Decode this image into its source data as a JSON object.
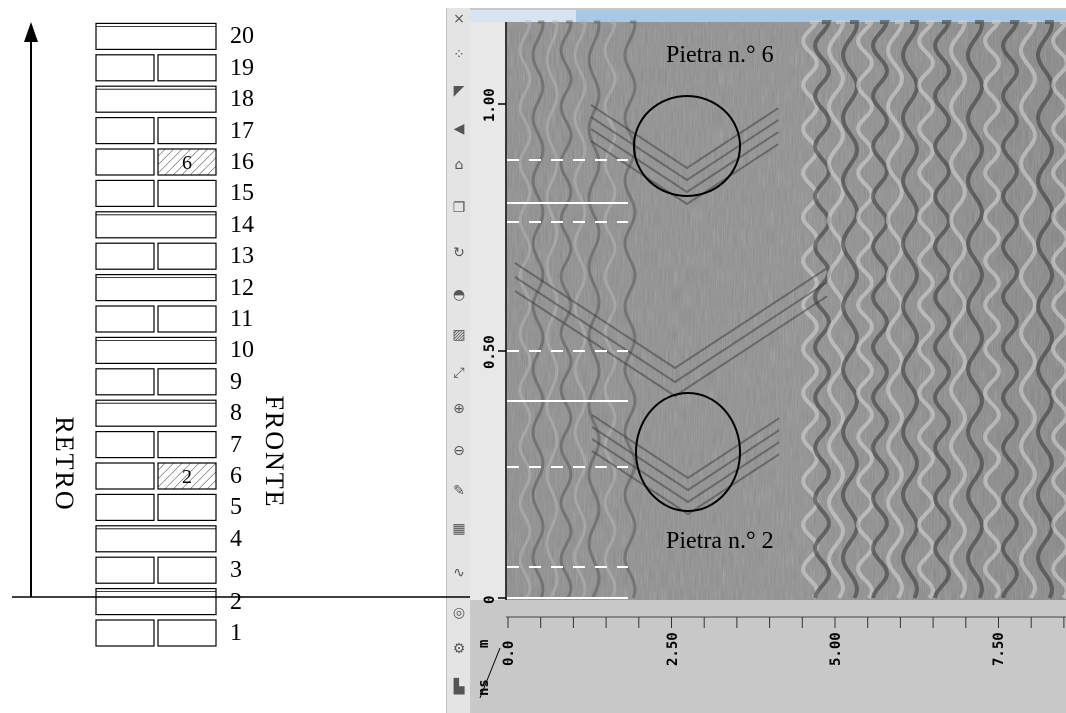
{
  "wall": {
    "rows": [
      "1",
      "2",
      "3",
      "4",
      "5",
      "6",
      "7",
      "8",
      "9",
      "10",
      "11",
      "12",
      "13",
      "14",
      "15",
      "16",
      "17",
      "18",
      "19",
      "20"
    ],
    "row_kinds": [
      "split",
      "full",
      "split",
      "full",
      "split",
      "split",
      "split",
      "full",
      "split",
      "full",
      "split",
      "full",
      "split",
      "full",
      "split",
      "split",
      "split",
      "full",
      "split",
      "full"
    ],
    "hatched": [
      {
        "row": 6,
        "label": "2"
      },
      {
        "row": 16,
        "label": "6"
      }
    ],
    "left_label": "RETRO",
    "right_label": "FRONTE"
  },
  "radargram": {
    "stone_top_label": "Pietra n.° 6",
    "stone_bottom_label": "Pietra n.° 2",
    "y_axis_unit": "m",
    "x_axis_unit": "ns",
    "y_ticks": [
      "1.00",
      "0.50",
      "0"
    ],
    "x_ticks": [
      "0.0",
      "2.50",
      "5.00",
      "7.50"
    ],
    "colors": {
      "toolbar_bg": "#e4e4e4",
      "scale_bg": "#c8c8c8",
      "top_bar": "#a8c8e8",
      "data_bg": "#8a8a8a"
    }
  },
  "toolbar": {
    "icons": [
      "close-icon",
      "dots-icon",
      "select-arrow-icon",
      "play-back-icon",
      "home-icon",
      "copy-icon",
      "refresh-icon",
      "circle-half-icon",
      "zoom-region-icon",
      "expand-icon",
      "zoom-in-icon",
      "zoom-out-icon",
      "paint-icon",
      "grid-icon",
      "curve-icon",
      "target-icon",
      "gear-icon",
      "page-icon"
    ]
  }
}
